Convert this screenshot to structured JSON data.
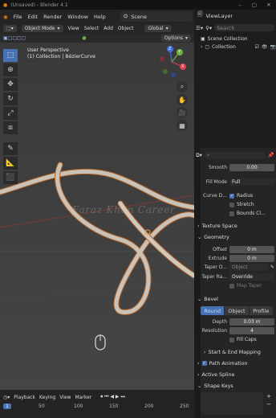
{
  "window": {
    "title": "(Unsaved) - Blender 4.1"
  },
  "menu": {
    "items": [
      "File",
      "Edit",
      "Render",
      "Window",
      "Help"
    ],
    "scene": "Scene",
    "view_layer": "ViewLayer"
  },
  "header": {
    "mode": "Object Mode",
    "menus": [
      "View",
      "Select",
      "Add",
      "Object"
    ],
    "orientation": "Global",
    "options": "Options"
  },
  "viewport": {
    "info_line1": "User Perspective",
    "info_line2": "(1) Collection | BézierCurve",
    "watermark": "Faraz Khan Career",
    "gizmo": {
      "x": "X",
      "y": "Y",
      "z": "Z"
    }
  },
  "outliner": {
    "search_placeholder": "Search",
    "scene_collection": "Scene Collection",
    "collection": "Collection"
  },
  "properties": {
    "search_placeholder": "",
    "smooth": {
      "label": "Smooth",
      "value": "0.00"
    },
    "fill_mode": {
      "label": "Fill Mode",
      "value": "Full"
    },
    "curve_deform": {
      "label": "Curve D...",
      "opts": [
        "Radius",
        "Stretch",
        "Bounds Cl..."
      ]
    },
    "texture_space": "Texture Space",
    "geometry": "Geometry",
    "offset": {
      "label": "Offset",
      "value": "0 m"
    },
    "extrude": {
      "label": "Extrude",
      "value": "0 m"
    },
    "taper_object": {
      "label": "Taper O...",
      "value": "Object"
    },
    "taper_radius": {
      "label": "Taper Ra...",
      "value": "Override"
    },
    "map_taper": "Map Taper",
    "bevel": "Bevel",
    "bevel_tabs": [
      "Round",
      "Object",
      "Profile"
    ],
    "depth": {
      "label": "Depth",
      "value": "0.03 m"
    },
    "resolution": {
      "label": "Resolution",
      "value": "4"
    },
    "fill_caps": "Fill Caps",
    "start_end": "Start & End Mapping",
    "path_animation": "Path Animation",
    "active_spline": "Active Spline",
    "shape_keys": "Shape Keys"
  },
  "timeline": {
    "menus": [
      "Playback",
      "Keying",
      "View",
      "Marker"
    ],
    "frames": [
      "1",
      "50",
      "100",
      "150",
      "200",
      "250"
    ],
    "current_frame": "1"
  }
}
